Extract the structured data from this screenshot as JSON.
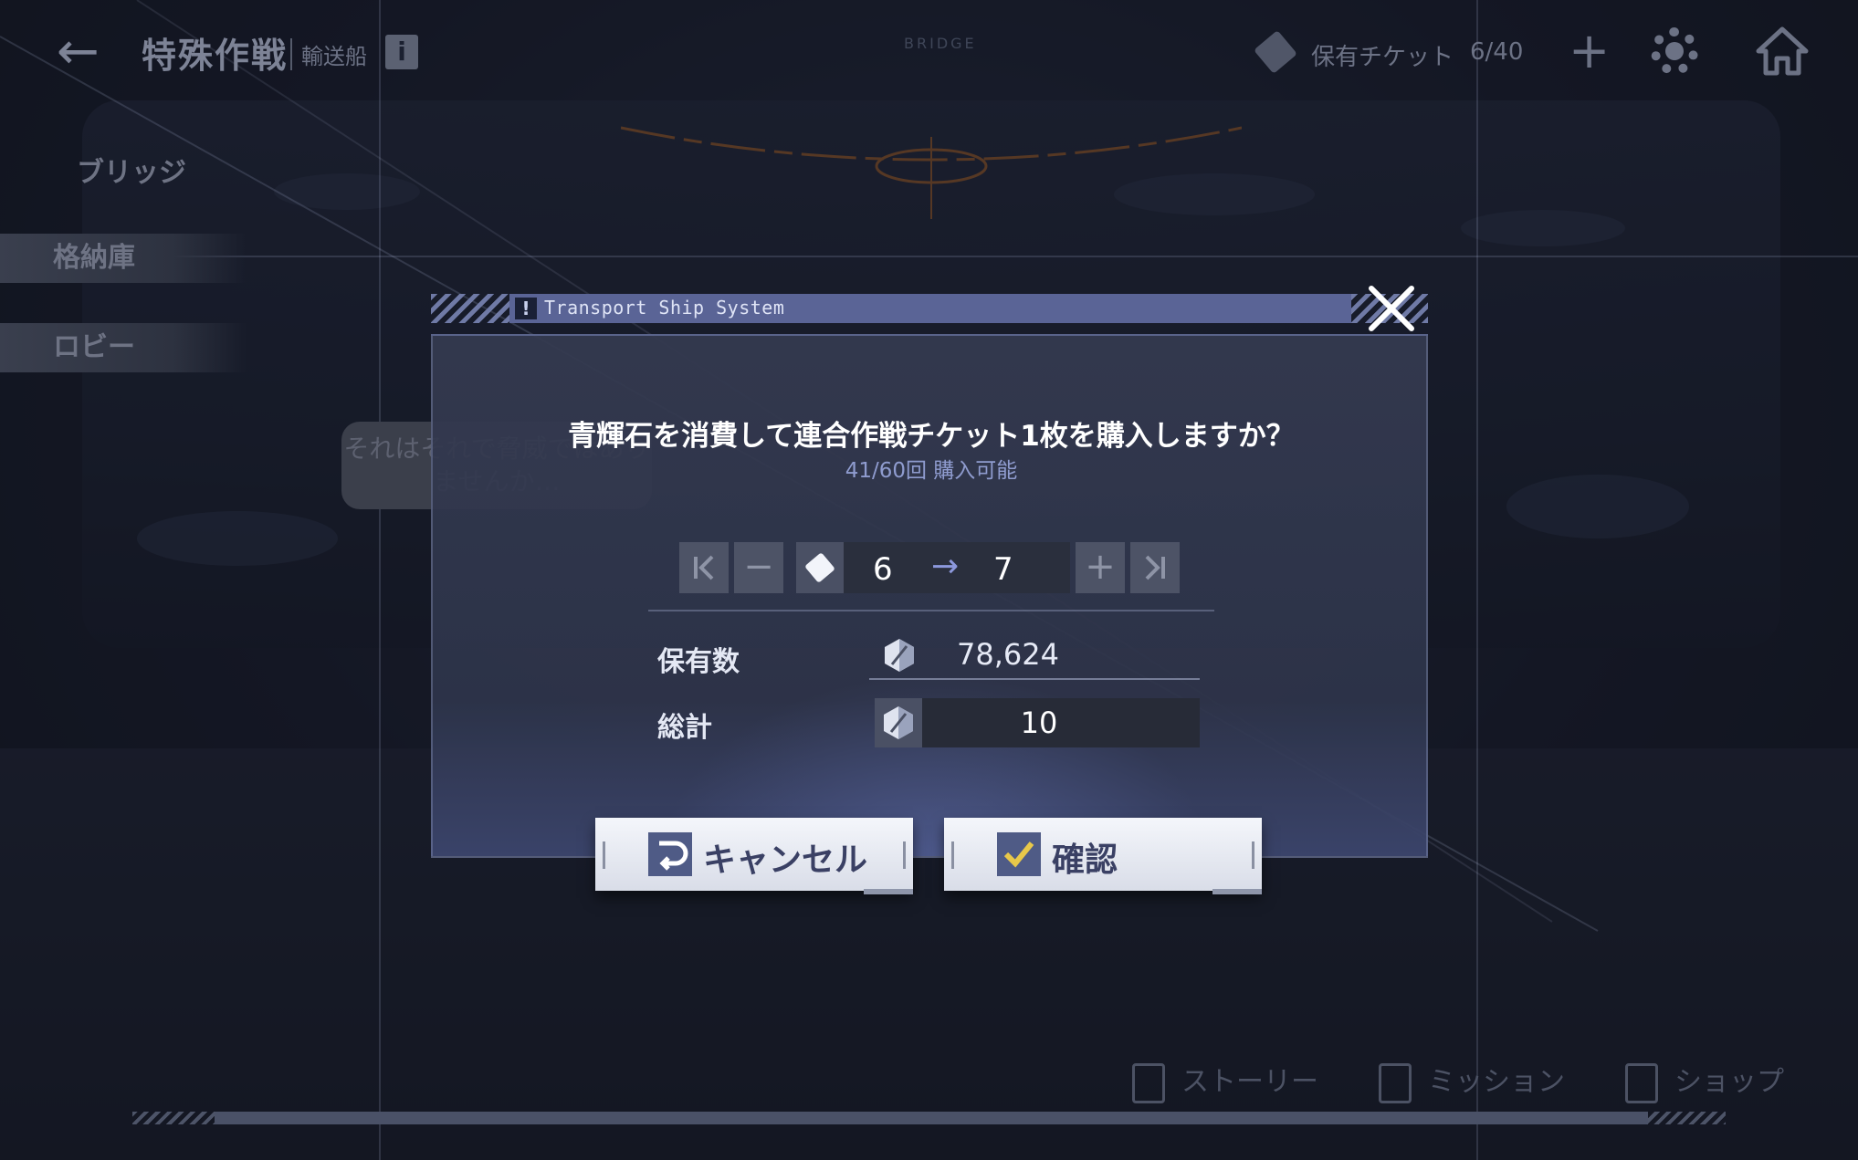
{
  "topbar": {
    "back_label": "←",
    "title": "特殊作戦",
    "subtitle": "輸送船",
    "info_label": "i",
    "bridge_label": "BRIDGE",
    "ticket_label": "保有チケット",
    "ticket_count": "6/40",
    "plus_label": "+"
  },
  "side_menu": {
    "items": [
      "ブリッジ",
      "格納庫",
      "ロビー"
    ]
  },
  "speech_bubble": "それはそれで脅威ではありませんか…",
  "bottom_nav": {
    "items": [
      "ストーリー",
      "ミッション",
      "ショップ"
    ]
  },
  "modal": {
    "header_title": "Transport Ship System",
    "warn_label": "!",
    "question": "青輝石を消費して連合作戦チケット1枚を購入しますか？",
    "availability": "41/60回 購入可能",
    "stepper": {
      "min_label": "|<",
      "minus_label": "−",
      "from": "6",
      "arrow": "→",
      "to": "7",
      "plus_label": "+",
      "max_label": ">|"
    },
    "owned_label": "保有数",
    "owned_value": "78,624",
    "total_label": "総計",
    "total_value": "10",
    "cancel_label": "キャンセル",
    "confirm_label": "確認"
  },
  "colors": {
    "header_bar": "#5a6496",
    "button_face": "#eef0f6",
    "button_text": "#3a4064",
    "confirm_check": "#e8c84a",
    "accent_arrow": "#8c98dc"
  },
  "icons": {
    "back": "back-arrow-icon",
    "info": "info-icon",
    "ticket": "ticket-icon",
    "settings": "gear-icon",
    "home": "home-icon",
    "close": "close-icon",
    "gem": "pyroxene-gem-icon",
    "cancel": "cancel-return-icon",
    "confirm": "check-icon"
  }
}
